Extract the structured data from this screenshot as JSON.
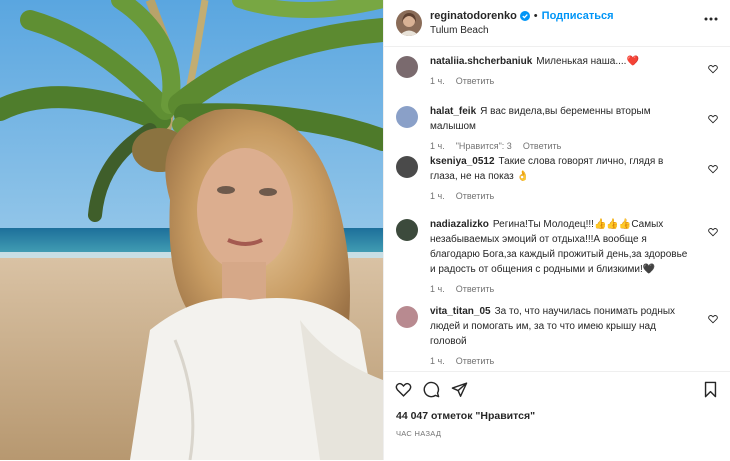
{
  "header": {
    "username": "reginatodorenko",
    "separator": "•",
    "follow_label": "Подписаться",
    "location": "Tulum Beach",
    "avatar_icon": "profile-avatar",
    "verified_icon": "verified-badge-icon",
    "more_icon": "more-options-icon"
  },
  "comments": [
    {
      "user": "nataliia.shcherbaniuk",
      "text": "Миленькая наша....❤️",
      "time": "1 ч.",
      "likes": "",
      "reply": "Ответить",
      "avatar_color": "#7a6a6e"
    },
    {
      "user": "halat_feik",
      "text": "Я вас видела,вы беременны вторым малышом",
      "time": "1 ч.",
      "likes": "\"Нравится\": 3",
      "reply": "Ответить",
      "avatar_color": "#8aa0c8"
    },
    {
      "user": "kseniya_0512",
      "text": "Такие слова говорят лично, глядя в глаза, не на показ 👌",
      "time": "1 ч.",
      "likes": "",
      "reply": "Ответить",
      "avatar_color": "#4a4a4a"
    },
    {
      "user": "nadiazalizko",
      "text": "Регина!Ты Молодец!!!👍👍👍Самых незабываемых эмоций от отдыха!!!А вообще я благодарю Бога,за каждый прожитый день,за здоровье и радость от общения с родными и близкими!🖤",
      "time": "1 ч.",
      "likes": "",
      "reply": "Ответить",
      "avatar_color": "#3c4a3c"
    },
    {
      "user": "vita_titan_05",
      "text": "За то, что научилась понимать родных людей и помогать им, за то что имею крышу над головой",
      "time": "1 ч.",
      "likes": "",
      "reply": "Ответить",
      "avatar_color": "#b88a90"
    }
  ],
  "actions": {
    "like_icon": "heart-icon",
    "comment_icon": "comment-icon",
    "share_icon": "share-icon",
    "save_icon": "bookmark-icon",
    "likes_text": "44 047 отметок \"Нравится\"",
    "time_text": "ЧАС НАЗАД"
  },
  "colors": {
    "accent": "#0095f6",
    "muted": "#737373",
    "text": "#262626",
    "verified": "#0095f6"
  }
}
